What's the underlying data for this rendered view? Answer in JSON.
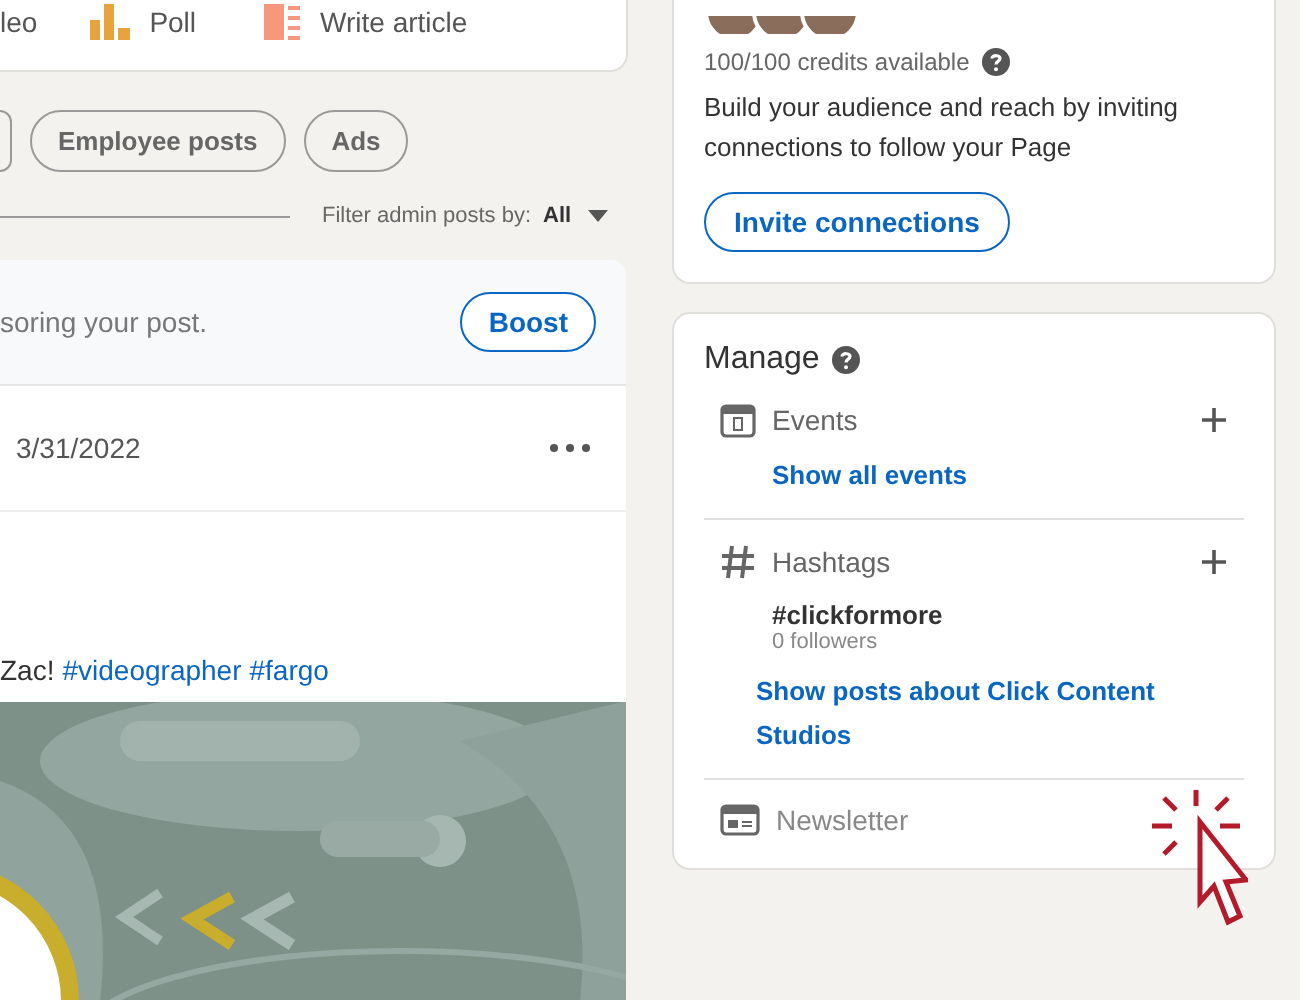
{
  "share_bar": {
    "items": [
      {
        "label": "leo",
        "kind": "cut"
      },
      {
        "label": "Poll",
        "kind": "poll"
      },
      {
        "label": "Write article",
        "kind": "article"
      }
    ]
  },
  "filter_chips": [
    {
      "kind": "cut"
    },
    {
      "label": "Employee posts",
      "kind": "chip"
    },
    {
      "label": "Ads",
      "kind": "chip"
    }
  ],
  "admin_filter": {
    "label": "Filter admin posts by:",
    "value": "All"
  },
  "post": {
    "sponsor_text": "soring your post.",
    "boost_button": "Boost",
    "date": "3/31/2022",
    "text": "Zac!",
    "hashtags": [
      "#videographer",
      "#fargo"
    ],
    "image": {
      "kind": "picture"
    }
  },
  "invite_card": {
    "credits": "100/100 credits available",
    "description": "Build your audience and reach by inviting connections to follow your Page",
    "button": "Invite connections"
  },
  "manage": {
    "title": "Manage",
    "sections": [
      {
        "kind": "events",
        "label": "Events",
        "links": [
          "Show all events"
        ]
      },
      {
        "kind": "hashtags",
        "label": "Hashtags",
        "tag": "#clickformore",
        "followers": "0 followers",
        "links": [
          "Show posts about Click Content Studios"
        ]
      },
      {
        "kind": "newsletter",
        "label": "Newsletter"
      }
    ]
  }
}
